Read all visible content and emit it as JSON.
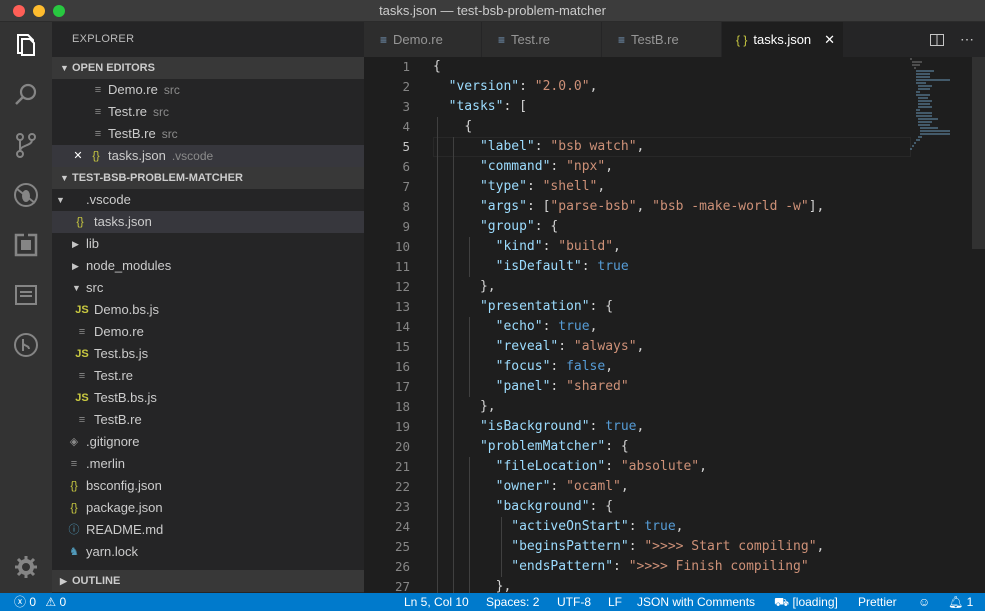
{
  "window": {
    "title": "tasks.json — test-bsb-problem-matcher",
    "traffic_lights": [
      "#ff5f57",
      "#febc2e",
      "#28c840"
    ]
  },
  "activity_bar": [
    "explorer-icon",
    "search-icon",
    "source-control-icon",
    "debug-icon",
    "extensions-icon",
    "panel-icon",
    "git-lens-icon",
    "settings-gear-icon"
  ],
  "sidebar": {
    "title": "EXPLORER",
    "open_editors": {
      "header": "OPEN EDITORS",
      "items": [
        {
          "name": "Demo.re",
          "desc": "src",
          "icon": "lines-icon"
        },
        {
          "name": "Test.re",
          "desc": "src",
          "icon": "lines-icon"
        },
        {
          "name": "TestB.re",
          "desc": "src",
          "icon": "lines-icon"
        },
        {
          "name": "tasks.json",
          "desc": ".vscode",
          "icon": "braces-icon",
          "close": "✕"
        }
      ]
    },
    "project": {
      "header": "TEST-BSB-PROBLEM-MATCHER",
      "items": [
        {
          "name": ".vscode"
        },
        {
          "name": "tasks.json",
          "icon_text": "{}"
        },
        {
          "name": "lib"
        },
        {
          "name": "node_modules"
        },
        {
          "name": "src"
        },
        {
          "name": "Demo.bs.js",
          "icon_text": "JS"
        },
        {
          "name": "Demo.re"
        },
        {
          "name": "Test.bs.js",
          "icon_text": "JS"
        },
        {
          "name": "Test.re"
        },
        {
          "name": "TestB.bs.js",
          "icon_text": "JS"
        },
        {
          "name": "TestB.re"
        },
        {
          "name": ".gitignore"
        },
        {
          "name": ".merlin"
        },
        {
          "name": "bsconfig.json",
          "icon_text": "{}"
        },
        {
          "name": "package.json",
          "icon_text": "{}"
        },
        {
          "name": "README.md"
        },
        {
          "name": "yarn.lock"
        }
      ]
    },
    "outline": {
      "header": "OUTLINE"
    }
  },
  "tabs": [
    {
      "label": "Demo.re",
      "active": false
    },
    {
      "label": "Test.re",
      "active": false
    },
    {
      "label": "TestB.re",
      "active": false
    },
    {
      "label": "tasks.json",
      "active": true,
      "icon_text": "{ }",
      "close": "✕"
    }
  ],
  "editor": {
    "current_line": 5,
    "line_numbers": [
      "1",
      "2",
      "3",
      "4",
      "5",
      "6",
      "7",
      "8",
      "9",
      "10",
      "11",
      "12",
      "13",
      "14",
      "15",
      "16",
      "17",
      "18",
      "19",
      "20",
      "21",
      "22",
      "23",
      "24",
      "25",
      "26",
      "27"
    ]
  },
  "statusbar": {
    "errors": "0",
    "warnings": "0",
    "position": "Ln 5, Col 10",
    "spaces": "Spaces: 2",
    "encoding": "UTF-8",
    "eol": "LF",
    "language": "JSON with Comments",
    "loading": "[loading]",
    "prettier": "Prettier",
    "notifications": "1"
  }
}
